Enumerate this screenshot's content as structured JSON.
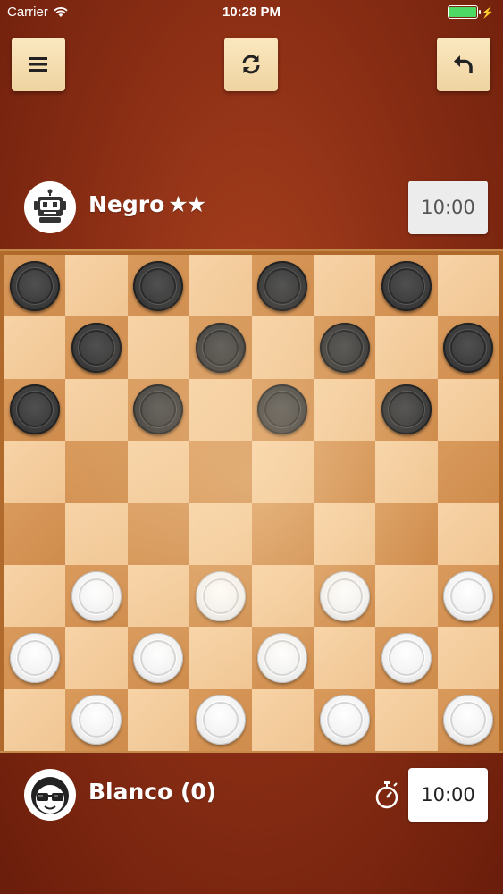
{
  "status_bar": {
    "carrier": "Carrier",
    "time": "10:28 PM",
    "battery_level": 1.0
  },
  "toolbar": {
    "menu_icon": "hamburger-menu-icon",
    "restart_icon": "refresh-icon",
    "undo_icon": "undo-arrow-icon"
  },
  "opponent": {
    "name": "Negro",
    "stars": "★★",
    "timer": "10:00",
    "avatar_icon": "robot-icon"
  },
  "player": {
    "name": "Blanco (0)",
    "timer": "10:00",
    "avatar_icon": "nerd-face-icon",
    "clock_icon": "stopwatch-icon"
  },
  "board": {
    "rows": [
      [
        "b",
        "",
        "b",
        "",
        "b",
        "",
        "b",
        ""
      ],
      [
        "",
        "b",
        "",
        "b",
        "",
        "b",
        "",
        "b"
      ],
      [
        "b",
        "",
        "b",
        "",
        "b",
        "",
        "b",
        ""
      ],
      [
        "",
        "",
        "",
        "",
        "",
        "",
        "",
        ""
      ],
      [
        "",
        "",
        "",
        "",
        "",
        "",
        "",
        ""
      ],
      [
        "",
        "w",
        "",
        "w",
        "",
        "w",
        "",
        "w"
      ],
      [
        "w",
        "",
        "w",
        "",
        "w",
        "",
        "w",
        ""
      ],
      [
        "",
        "w",
        "",
        "w",
        "",
        "w",
        "",
        "w"
      ]
    ]
  },
  "colors": {
    "background": "#8c2f15",
    "dark_square": "#d99a5c",
    "light_square": "#f7d3a6",
    "button": "#f5dcab"
  }
}
